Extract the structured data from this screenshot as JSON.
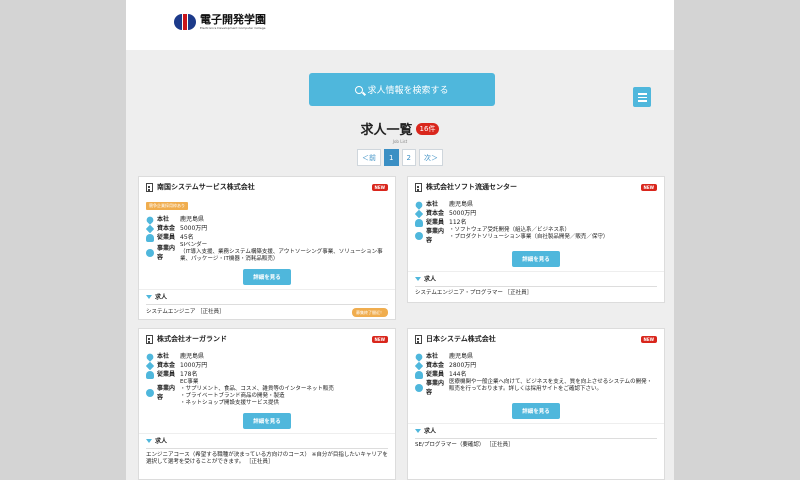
{
  "header": {
    "logo_jp": "電子開発学園",
    "logo_en": "Electronics Development Computer College"
  },
  "search": {
    "label": "求人情報を検索する"
  },
  "list": {
    "title": "求人一覧",
    "count": "16件",
    "subtitle": "Job List"
  },
  "pagination": {
    "prev": "＜前",
    "pages": [
      "1",
      "2"
    ],
    "next": "次＞",
    "active": "1"
  },
  "labels": {
    "location": "本社",
    "capital": "資本金",
    "employees": "従業員",
    "business": "事業内容",
    "detail": "詳細を見る",
    "jobs": "求人",
    "new": "NEW"
  },
  "cards": [
    {
      "name": "南国システムサービス株式会社",
      "tag": "競争企業採用枠あり",
      "location": "鹿児島県",
      "capital": "5000万円",
      "employees": "45名",
      "business": "SIベンダー\n（IT導入支援、業務システム構築支援、アウトソーシング事業、ソリューション事業、パッケージ・IT機器・消耗品販売）",
      "job": "システムエンジニア ［正社員］",
      "deadline": "募集終了間近！"
    },
    {
      "name": "株式会社ソフト流通センター",
      "location": "鹿児島県",
      "capital": "5000万円",
      "employees": "112名",
      "business": "・ソフトウェア受託開発（組込系／ビジネス系）\n・プロダクトソリューション事業（自社製品開発／販売／保守）",
      "job": "システムエンジニア・プログラマー ［正社員］"
    },
    {
      "name": "株式会社オーガランド",
      "location": "鹿児島県",
      "capital": "1000万円",
      "employees": "178名",
      "business": "EC事業\n・サプリメント、食品、コスメ、雑貨等のインターネット販売\n・プライベートブランド商品の開発・製造\n・ネットショップ開設支援サービス提供",
      "job": "エンジニアコース（希望する職種が決まっている方向けのコース） ※自分が目指したいキャリアを選択して選考を受けることができます。 ［正社員］"
    },
    {
      "name": "日本システム株式会社",
      "location": "鹿児島県",
      "capital": "2800万円",
      "employees": "144名",
      "business": "医療機関や一般企業へ向けて、ビジネスを支え、質を向上させるシステムの開発・販売を行っております。詳しくは採用サイトをご確認下さい。",
      "job": "SE/プログラマー（要確認） ［正社員］"
    }
  ]
}
